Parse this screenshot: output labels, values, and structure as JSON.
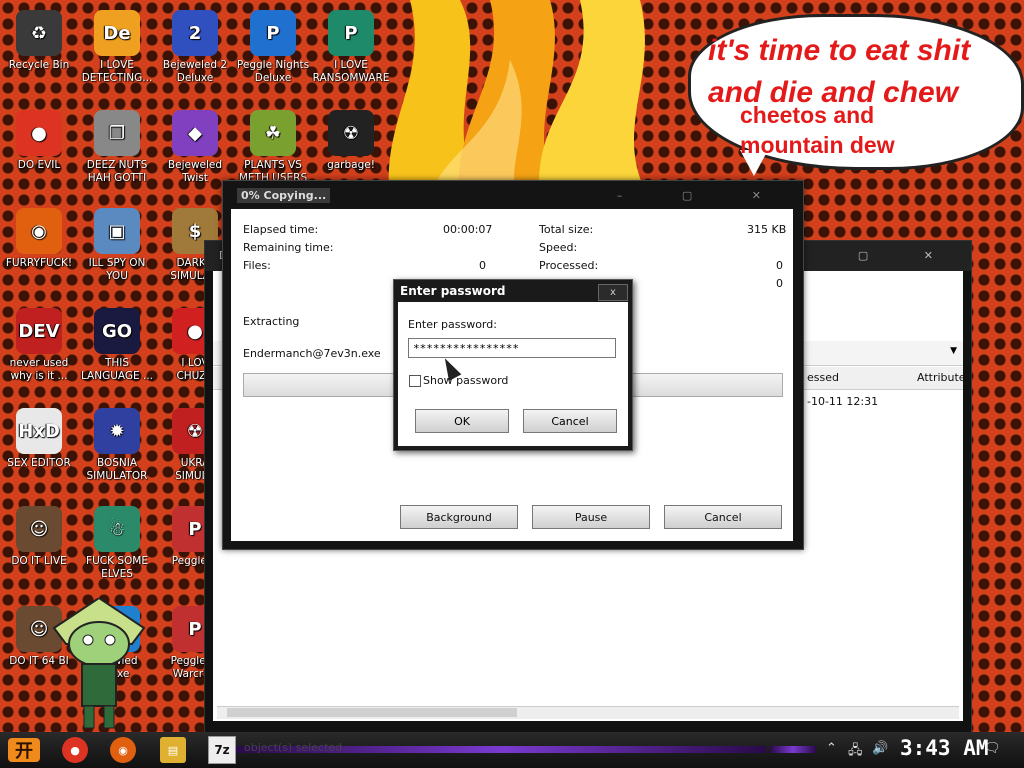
{
  "desktop": {
    "speech_bubble": {
      "line1": "it's time to eat shit",
      "line2": "and die and chew",
      "line3": "cheetos and",
      "line4": "mountain dew"
    },
    "icons": [
      {
        "label": "Recycle Bin",
        "icon": "recycle-bin-icon",
        "glyph": "♻",
        "color": "#3a3a3a"
      },
      {
        "label": "I LOVE\nDETECTING...",
        "icon": "detect-it-easy-icon",
        "glyph": "De",
        "color": "#f0a020"
      },
      {
        "label": "Bejeweled 2\nDeluxe",
        "icon": "bejeweled-2-icon",
        "glyph": "2",
        "color": "#3050c0"
      },
      {
        "label": "Peggle Nights\nDeluxe",
        "icon": "peggle-nights-icon",
        "glyph": "P",
        "color": "#2070d0"
      },
      {
        "label": "I LOVE\nRANSOMWARE",
        "icon": "publisher-icon",
        "glyph": "P",
        "color": "#1e8a6a"
      },
      {
        "label": "DO EVIL",
        "icon": "chrome-icon",
        "glyph": "●",
        "color": "#dd3322"
      },
      {
        "label": "DEEZ NUTS\nHAH GOTTI",
        "icon": "windows-stack-icon",
        "glyph": "❐",
        "color": "#888888"
      },
      {
        "label": "Bejeweled\nTwist",
        "icon": "bejeweled-twist-icon",
        "glyph": "◆",
        "color": "#8040c0"
      },
      {
        "label": "PLANTS VS\nMETH USERS",
        "icon": "plants-vs-zombies-icon",
        "glyph": "☘",
        "color": "#7aa030"
      },
      {
        "label": "garbage!",
        "icon": "garbage-app-icon",
        "glyph": "☢",
        "color": "#222222"
      },
      {
        "label": "FURRYFUCK!",
        "icon": "firefox-icon",
        "glyph": "◉",
        "color": "#e06010"
      },
      {
        "label": "ILL SPY ON\nYOU",
        "icon": "network-spy-icon",
        "glyph": "▣",
        "color": "#5a8ac0"
      },
      {
        "label": "DARKO\nSIMULA...",
        "icon": "money-bag-icon",
        "glyph": "$",
        "color": "#a07a3a"
      },
      {
        "label": "never used\nwhy is it ...",
        "icon": "dev-cpp-icon",
        "glyph": "DEV",
        "color": "#c02020"
      },
      {
        "label": "THIS\nLANGUAGE ...",
        "icon": "go-lang-icon",
        "glyph": "GO",
        "color": "#1a1a40"
      },
      {
        "label": "I LOV\nCHUZZ",
        "icon": "chuzzle-icon",
        "glyph": "●",
        "color": "#d02020"
      },
      {
        "label": "SEX EDITOR",
        "icon": "hxd-editor-icon",
        "glyph": "HxD",
        "color": "#e8e8e8"
      },
      {
        "label": "BOSNIA\nSIMULATOR",
        "icon": "spiked-ball-icon",
        "glyph": "✹",
        "color": "#3040a0"
      },
      {
        "label": "UKRA\nSIMULA",
        "icon": "radiation-icon",
        "glyph": "☢",
        "color": "#c02020"
      },
      {
        "label": "DO IT LIVE",
        "icon": "portrait-icon",
        "glyph": "☺",
        "color": "#6a4a30"
      },
      {
        "label": "FUCK SOME\nELVES",
        "icon": "elf-game-icon",
        "glyph": "☃",
        "color": "#2a8a6a"
      },
      {
        "label": "Peggle D",
        "icon": "peggle-deluxe-icon",
        "glyph": "P",
        "color": "#c03030"
      },
      {
        "label": "DO IT 64 BI",
        "icon": "portrait-64-icon",
        "glyph": "☺",
        "color": "#6a4a30"
      },
      {
        "label": "...ewled\nLuxe",
        "icon": "bejeweled-deluxe-icon",
        "glyph": "◆",
        "color": "#2080d0"
      },
      {
        "label": "Peggle W\nWarcraft",
        "icon": "peggle-wow-icon",
        "glyph": "P",
        "color": "#c03030"
      }
    ]
  },
  "back_window": {
    "title": "D",
    "col_processed": "essed",
    "col_attributes": "Attribute",
    "row_date": "-10-11 12:31"
  },
  "copy_window": {
    "title": "0% Copying...",
    "elapsed_label": "Elapsed time:",
    "elapsed_value": "00:00:07",
    "remaining_label": "Remaining time:",
    "files_label": "Files:",
    "files_value": "0",
    "total_size_label": "Total size:",
    "total_size_value": "315 KB",
    "speed_label": "Speed:",
    "processed_label": "Processed:",
    "processed_value": "0",
    "extra_value": "0",
    "extracting_label": "Extracting",
    "file_name": "Endermanch@7ev3n.exe",
    "progress": 0,
    "background_btn": "Background",
    "pause_btn": "Pause",
    "cancel_btn": "Cancel"
  },
  "password_dialog": {
    "title": "Enter password",
    "close": "x",
    "prompt": "Enter password:",
    "value": "****************",
    "show_label": "Show password",
    "ok": "OK",
    "cancel": "Cancel"
  },
  "taskbar": {
    "start_glyph": "开",
    "status": "object(s) selected",
    "seven_zip": "7z",
    "clock": "3:43 AM"
  }
}
